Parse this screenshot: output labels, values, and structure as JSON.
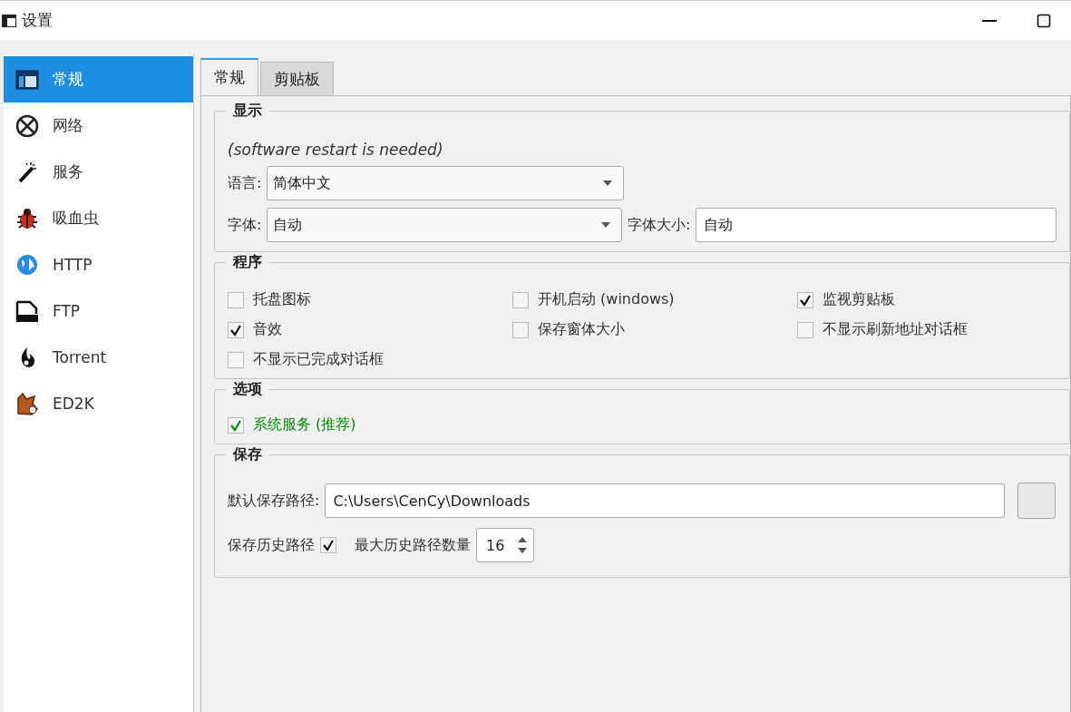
{
  "window": {
    "title": "设置"
  },
  "sidebar": {
    "items": [
      {
        "label": "常规",
        "selected": true
      },
      {
        "label": "网络",
        "selected": false
      },
      {
        "label": "服务",
        "selected": false
      },
      {
        "label": "吸血虫",
        "selected": false
      },
      {
        "label": "HTTP",
        "selected": false
      },
      {
        "label": "FTP",
        "selected": false
      },
      {
        "label": "Torrent",
        "selected": false
      },
      {
        "label": "ED2K",
        "selected": false
      }
    ]
  },
  "tabs": [
    {
      "label": "常规",
      "selected": true
    },
    {
      "label": "剪贴板",
      "selected": false
    }
  ],
  "display": {
    "title": "显示",
    "note": "(software restart is needed)",
    "language": {
      "label": "语言:",
      "value": "简体中文"
    },
    "font": {
      "label": "字体:",
      "value": "自动"
    },
    "font_size": {
      "label": "字体大小:",
      "value": "自动"
    }
  },
  "program": {
    "title": "程序",
    "options": [
      {
        "label": "托盘图标",
        "checked": false
      },
      {
        "label": "开机启动 (windows)",
        "checked": false
      },
      {
        "label": "监视剪贴板",
        "checked": true
      },
      {
        "label": "音效",
        "checked": true
      },
      {
        "label": "保存窗体大小",
        "checked": false
      },
      {
        "label": "不显示刷新地址对话框",
        "checked": false
      },
      {
        "label": "不显示已完成对话框",
        "checked": false
      }
    ]
  },
  "options": {
    "title": "选项",
    "items": [
      {
        "label": "系统服务 (推荐)",
        "checked": true
      }
    ]
  },
  "save": {
    "title": "保存",
    "path": {
      "label": "默认保存路径:",
      "value": "C:\\Users\\CenCy\\Downloads"
    },
    "history": {
      "label": "保存历史路径",
      "checked": true
    },
    "max_history": {
      "label": "最大历史路径数量",
      "value": "16"
    }
  }
}
